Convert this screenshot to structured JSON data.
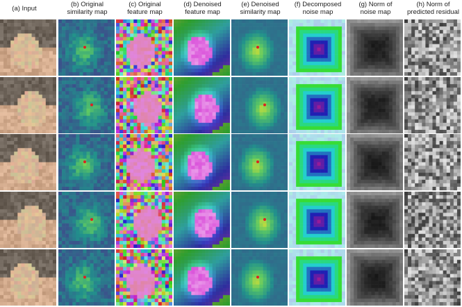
{
  "figure": {
    "columns": [
      {
        "label": "(a) Input",
        "type": "input"
      },
      {
        "label": "(b) Original\nsimilarity map",
        "type": "sim"
      },
      {
        "label": "(c) Original\nfeature map",
        "type": "feat"
      },
      {
        "label": "(d) Denoised\nfeature map",
        "type": "dfeat"
      },
      {
        "label": "(e) Denoised\nsimilarity map",
        "type": "dsim"
      },
      {
        "label": "(f) Decomposed\nnoise map",
        "type": "noise"
      },
      {
        "label": "(g) Norm of\nnoise map",
        "type": "norm"
      },
      {
        "label": "(h) Norm of\npredicted residual",
        "type": "resid"
      }
    ],
    "rows": 5,
    "colors": {
      "sim_base": "#2f5b8c",
      "sim_high": "#c8dd3a",
      "noise_magenta": "#b020a0",
      "noise_yellow": "#e8e040",
      "cat_fur": "#c9a58a",
      "background": "#ffffff"
    }
  }
}
